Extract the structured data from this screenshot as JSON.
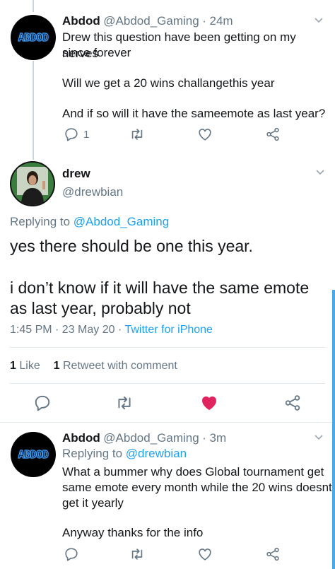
{
  "tweet1": {
    "name": "Abdod",
    "handle": "@Abdod_Gaming",
    "time": "· 24m",
    "avatar_text": "ABDOD",
    "line1": "Drew this question have been getting on my nerves",
    "line2": "since forever",
    "line3": "Will we get a 20 wins challangethis year",
    "line4": "And if so will it have the sameemote as last year?",
    "reply_count": "1"
  },
  "main": {
    "name": "drew",
    "handle": "@drewbian",
    "replying_prefix": "Replying to",
    "replying_handle": "@Abdod_Gaming",
    "line1": "yes there should be one this year.",
    "line2": "i don’t know if it will have the same emote",
    "line3": "as last year, probably not",
    "time": "1:45 PM · 23 May 20 ·",
    "source": "Twitter for iPhone",
    "likes_num": "1",
    "likes_label": "Like",
    "retweets_num": "1",
    "retweets_label": "Retweet with comment"
  },
  "tweet3": {
    "name": "Abdod",
    "handle": "@Abdod_Gaming",
    "time": "· 3m",
    "avatar_text": "ABDOD",
    "replying_prefix": "Replying to",
    "replying_handle": "@drewbian",
    "line1": "What a bummer why does Global tournament get",
    "line2": "same emote every month while the 20 wins doesnt",
    "line3": "get it yearly",
    "line4": "Anyway thanks for the info"
  },
  "colors": {
    "accent": "#1da1f2",
    "like_active": "#e0245e",
    "muted": "#657786"
  },
  "icons": [
    "reply-icon",
    "retweet-icon",
    "like-icon",
    "share-icon",
    "chevron-down-icon"
  ]
}
